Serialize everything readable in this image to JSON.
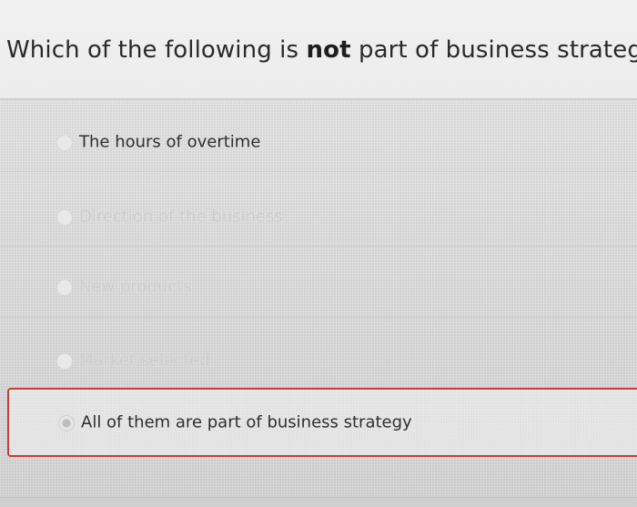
{
  "question": {
    "prefix": "Which of the following is ",
    "emphasis": "not",
    "suffix": " part of business strategy?"
  },
  "options": [
    {
      "label": "The hours of overtime",
      "state": "active"
    },
    {
      "label": "Direction of the business",
      "state": "faded"
    },
    {
      "label": "New products",
      "state": "faded"
    },
    {
      "label": "Market selected",
      "state": "faded"
    },
    {
      "label": "All of them are part of business strategy",
      "state": "selected"
    }
  ],
  "colors": {
    "selection_border": "#c93c3c",
    "text": "#2f2f2f",
    "faded_text": "#cdcdcd"
  },
  "misc": {
    "mark": "?"
  }
}
